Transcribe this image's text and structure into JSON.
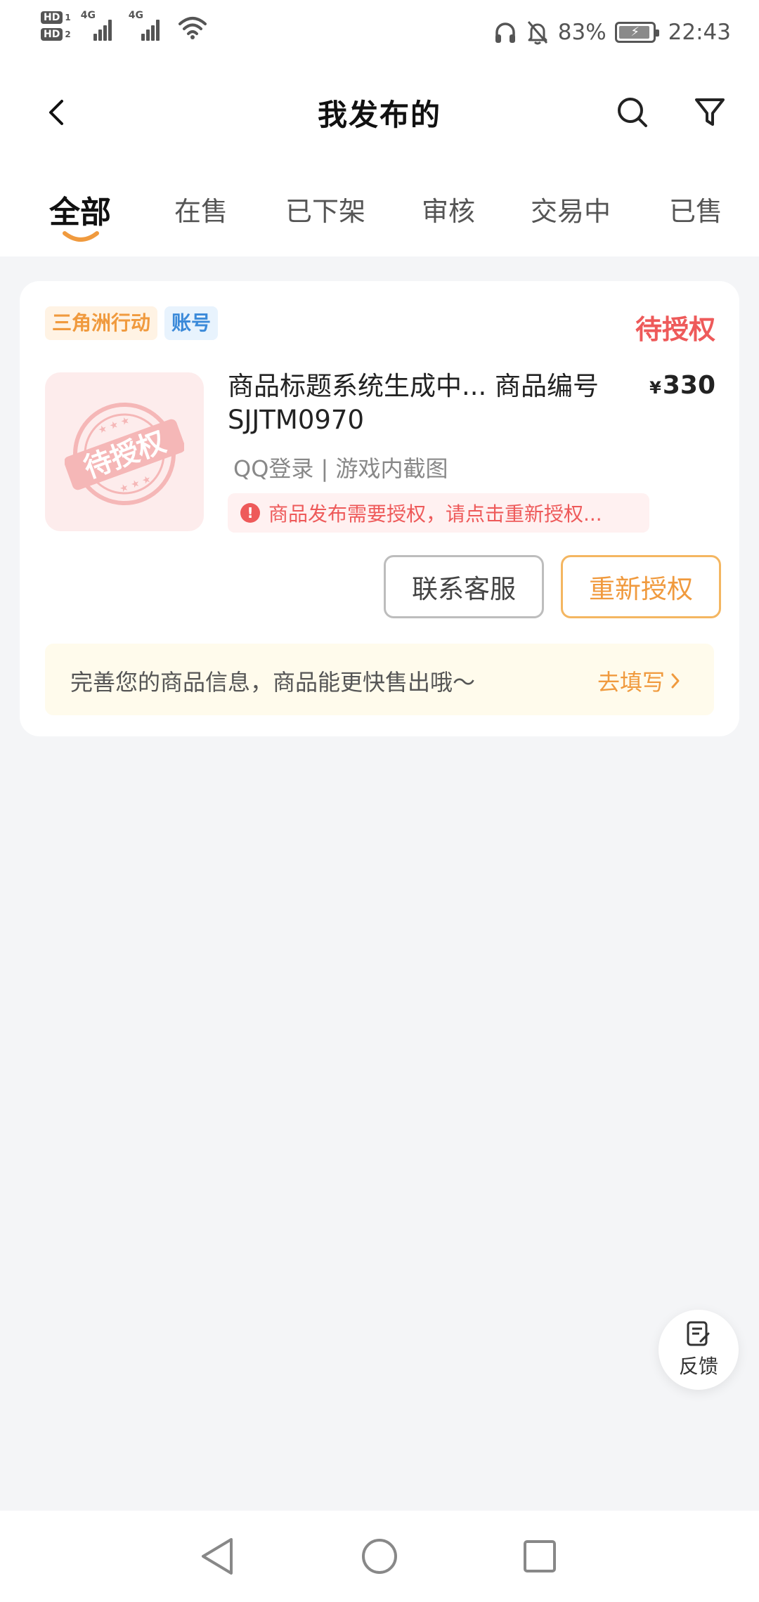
{
  "status_bar": {
    "hd1": "HD",
    "hd1_num": "1",
    "hd2": "HD",
    "hd2_num": "2",
    "net1": "4G",
    "net2": "4G",
    "battery_pct": "83%",
    "battery_level": 0.83,
    "time": "22:43"
  },
  "header": {
    "title": "我发布的"
  },
  "tabs": [
    {
      "label": "全部",
      "active": true
    },
    {
      "label": "在售"
    },
    {
      "label": "已下架"
    },
    {
      "label": "审核"
    },
    {
      "label": "交易中"
    },
    {
      "label": "已售"
    }
  ],
  "card": {
    "tags": [
      "三角洲行动",
      "账号"
    ],
    "status": "待授权",
    "thumb_stamp": "待授权",
    "title": "商品标题系统生成中... 商品编号SJJTM0970",
    "price_symbol": "¥",
    "price": "330",
    "subtitle": "QQ登录 | 游戏内截图",
    "warning": "商品发布需要授权，请点击重新授权...",
    "btn_contact": "联系客服",
    "btn_reauth": "重新授权",
    "hint_text": "完善您的商品信息，商品能更快售出哦～",
    "hint_link": "去填写"
  },
  "feedback": {
    "label": "反馈"
  },
  "colors": {
    "accent_orange": "#f09a3e",
    "status_red": "#ee5a5a",
    "tag_blue": "#3b8ad9"
  }
}
